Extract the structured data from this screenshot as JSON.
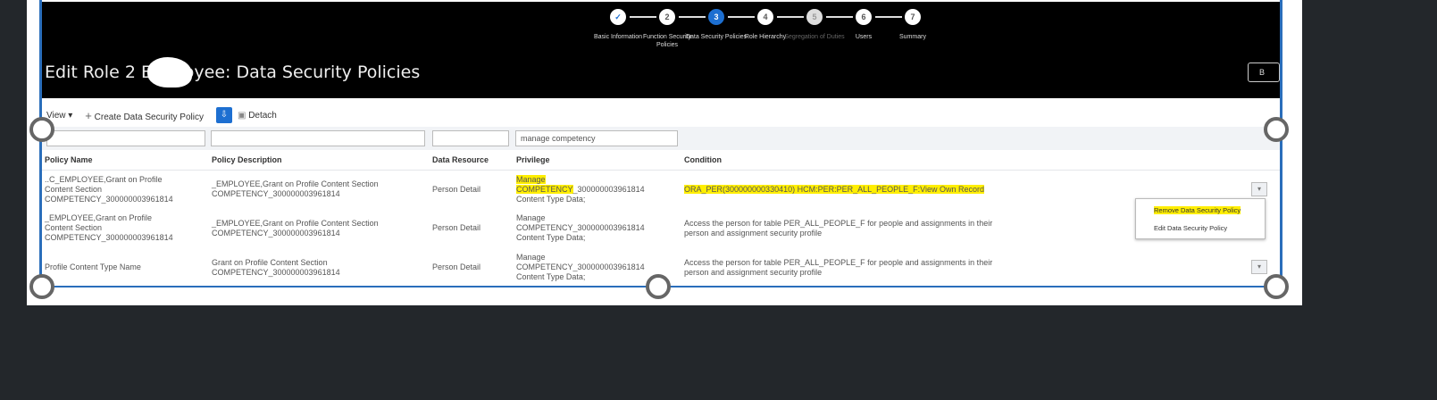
{
  "train": {
    "steps": [
      {
        "num": "✓",
        "label": "Basic Information",
        "state": "done"
      },
      {
        "num": "2",
        "label": "Function Security Policies",
        "state": "normal"
      },
      {
        "num": "3",
        "label": "Data Security Policies",
        "state": "active"
      },
      {
        "num": "4",
        "label": "Role Hierarchy",
        "state": "normal"
      },
      {
        "num": "5",
        "label": "Segregation of Duties",
        "state": "disabled"
      },
      {
        "num": "6",
        "label": "Users",
        "state": "normal"
      },
      {
        "num": "7",
        "label": "Summary",
        "state": "normal"
      }
    ]
  },
  "header": {
    "title": "Edit Role      2 Employee: Data Security Policies",
    "back_button": "B"
  },
  "toolbar": {
    "view": "View ▾",
    "create": "Create Data Security Policy",
    "detach": "Detach"
  },
  "filters": {
    "privilege": "manage competency"
  },
  "columns": [
    "Policy Name",
    "Policy Description",
    "Data Resource",
    "Privilege",
    "Condition"
  ],
  "rows": [
    {
      "name": [
        "..C_EMPLOYEE,Grant on Profile",
        "Content Section",
        "COMPETENCY_300000003961814"
      ],
      "desc": [
        "   _EMPLOYEE,Grant on Profile Content Section",
        "COMPETENCY_300000003961814"
      ],
      "resource": "Person Detail",
      "priv": [
        "Manage",
        "COMPETENCY",
        "_300000003961814",
        "Content Type Data;"
      ],
      "cond": [
        "ORA_PER(300000000330410) HCM:PER:PER_ALL_PEOPLE_F:View Own Record"
      ]
    },
    {
      "name": [
        "     _EMPLOYEE,Grant on Profile",
        "Content Section",
        "COMPETENCY_300000003961814"
      ],
      "desc": [
        "      _EMPLOYEE,Grant on Profile Content Section",
        "COMPETENCY_300000003961814"
      ],
      "resource": "Person Detail",
      "priv": [
        "Manage",
        "COMPETENCY_300000003961814",
        "Content Type Data;"
      ],
      "cond": [
        "Access the person for table PER_ALL_PEOPLE_F for people and assignments in their",
        "person and assignment security profile"
      ]
    },
    {
      "name": [
        "Profile Content Type Name"
      ],
      "desc": [
        "Grant on Profile Content Section",
        "COMPETENCY_300000003961814"
      ],
      "resource": "Person Detail",
      "priv": [
        "Manage",
        "COMPETENCY_300000003961814",
        "Content Type Data;"
      ],
      "cond": [
        "Access the person for table PER_ALL_PEOPLE_F for people and assignments in their",
        "person and assignment security profile"
      ]
    }
  ],
  "menu": {
    "remove": "Remove Data Security Policy",
    "edit": "Edit Data Security Policy"
  },
  "colors": {
    "accent": "#1d6fd1",
    "highlight": "#ffee00",
    "selection": "#2a6ebb"
  }
}
